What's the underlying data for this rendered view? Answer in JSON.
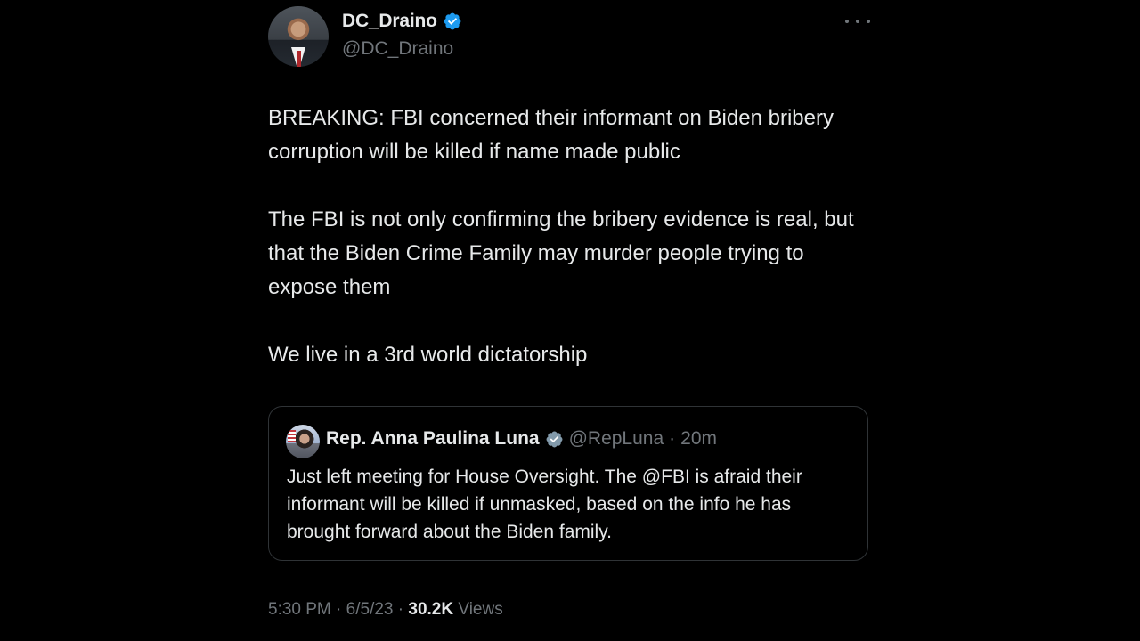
{
  "author": {
    "display_name": "DC_Draino",
    "handle": "@DC_Draino",
    "verified": true
  },
  "icons": {
    "avatar": "avatar-photo",
    "verified": "verified-badge-icon",
    "more": "more-options-icon",
    "verified_color": "#1d9bf0",
    "gold_verified_color": "#829aab"
  },
  "tweet": {
    "paragraphs": [
      "BREAKING: FBI concerned their informant on Biden bribery corruption will be killed if name made public",
      "The FBI is not only confirming the bribery evidence is real, but that the Biden Crime Family may murder people trying to expose them",
      "We live in a 3rd world dictatorship"
    ]
  },
  "quoted": {
    "display_name": "Rep. Anna Paulina Luna",
    "handle": "@RepLuna",
    "separator": "·",
    "time": "20m",
    "text": "Just left meeting for House Oversight. The @FBI is afraid their informant will be killed if unmasked, based on the info he has brought forward about the Biden family."
  },
  "meta": {
    "time": "5:30 PM",
    "sep1": "·",
    "date": "6/5/23",
    "sep2": "·",
    "views_count": "30.2K",
    "views_label": "Views"
  }
}
